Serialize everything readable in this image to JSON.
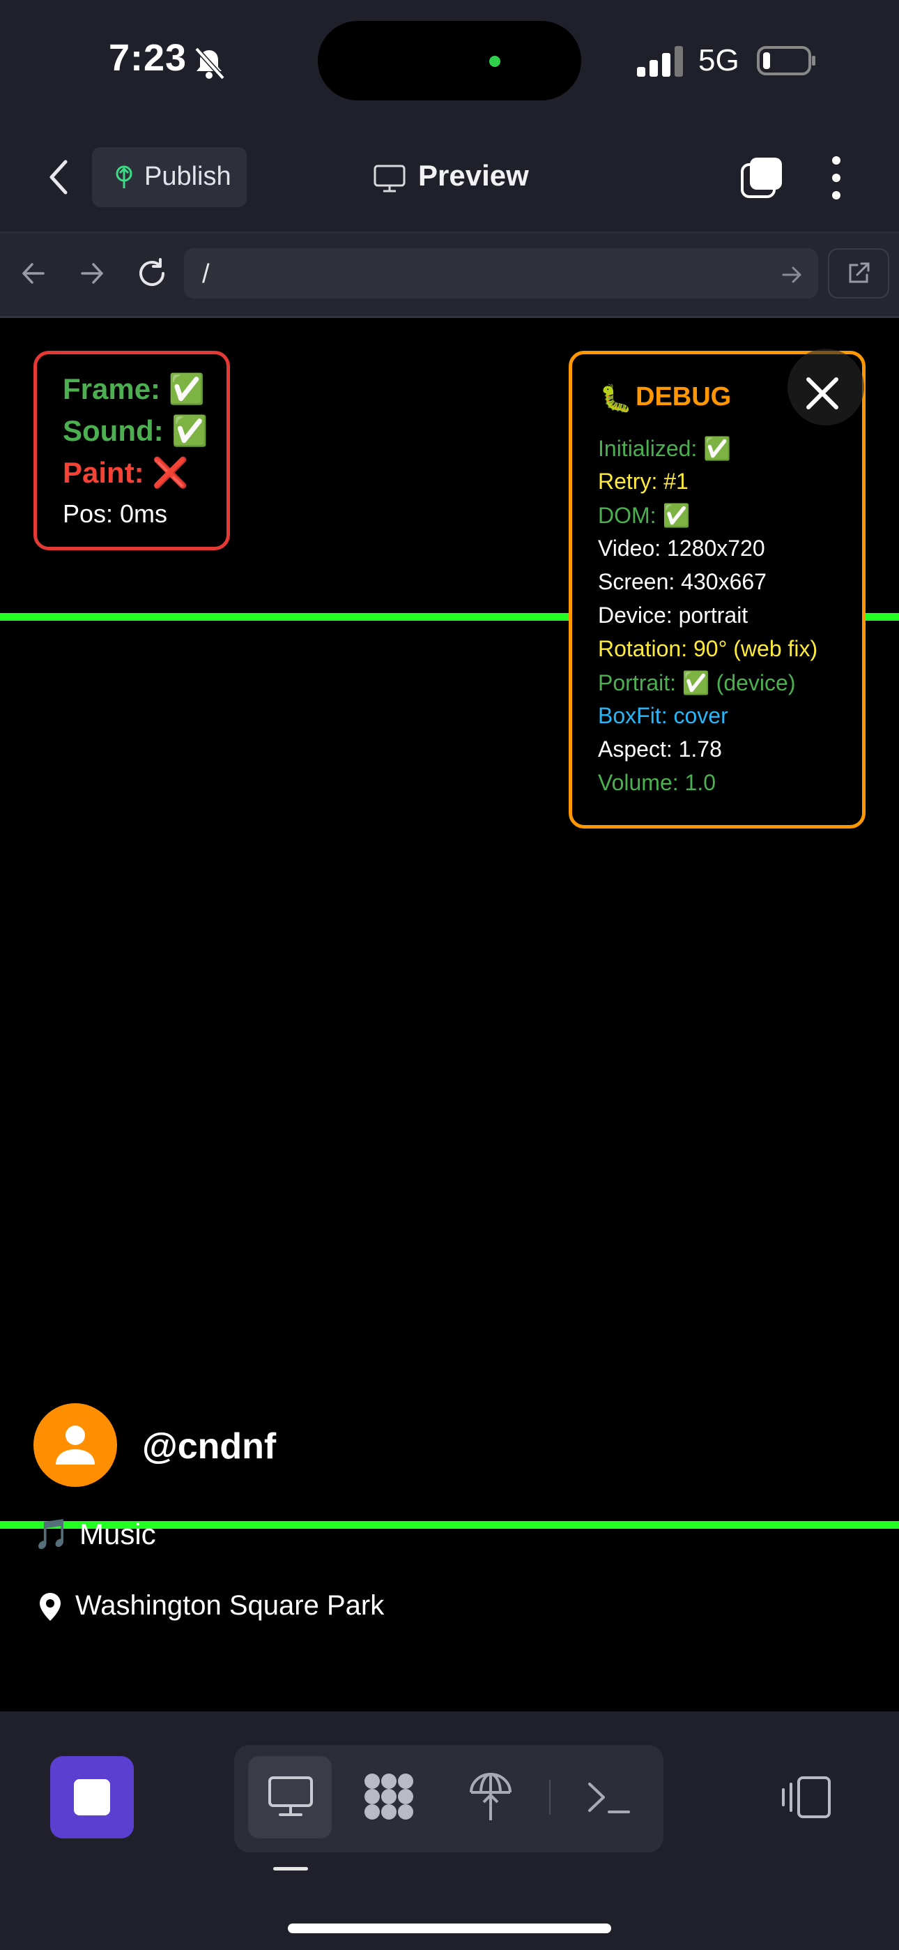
{
  "status_bar": {
    "time": "7:23",
    "network": "5G",
    "silent_icon": "bell-slash-icon",
    "signal_icon": "cellular-signal-icon",
    "battery_icon": "battery-low-icon"
  },
  "toolbar": {
    "back_icon": "chevron-left-icon",
    "publish_label": "Publish",
    "publish_icon": "publish-tree-icon",
    "preview_label": "Preview",
    "preview_icon": "monitor-icon",
    "windows_icon": "windows-stack-icon",
    "more_icon": "vertical-ellipsis-icon"
  },
  "browser": {
    "url": "/"
  },
  "overlay_status": {
    "frame": "Frame: ✅",
    "sound": "Sound: ✅",
    "paint": "Paint: ❌",
    "pos": "Pos: 0ms"
  },
  "debug": {
    "bug_emoji": "🐛",
    "title": "DEBUG",
    "lines": [
      "Initialized: ✅",
      "Retry: #1",
      "DOM: ✅",
      "Video: 1280x720",
      "Screen: 430x667",
      "Device: portrait",
      "Rotation: 90° (web fix)",
      "Portrait: ✅ (device)",
      "BoxFit: cover",
      "Aspect: 1.78",
      "Volume: 1.0"
    ]
  },
  "video_info": {
    "username": "@cndnf",
    "music_emoji": "🎵",
    "music_label": "Music",
    "location": "Washington Square Park"
  },
  "colors": {
    "accent_purple": "#5b3fd1",
    "avatar_orange": "#ff8f00",
    "guide_green": "#22ff22",
    "debug_orange": "#ff9800",
    "status_red": "#e53935"
  }
}
